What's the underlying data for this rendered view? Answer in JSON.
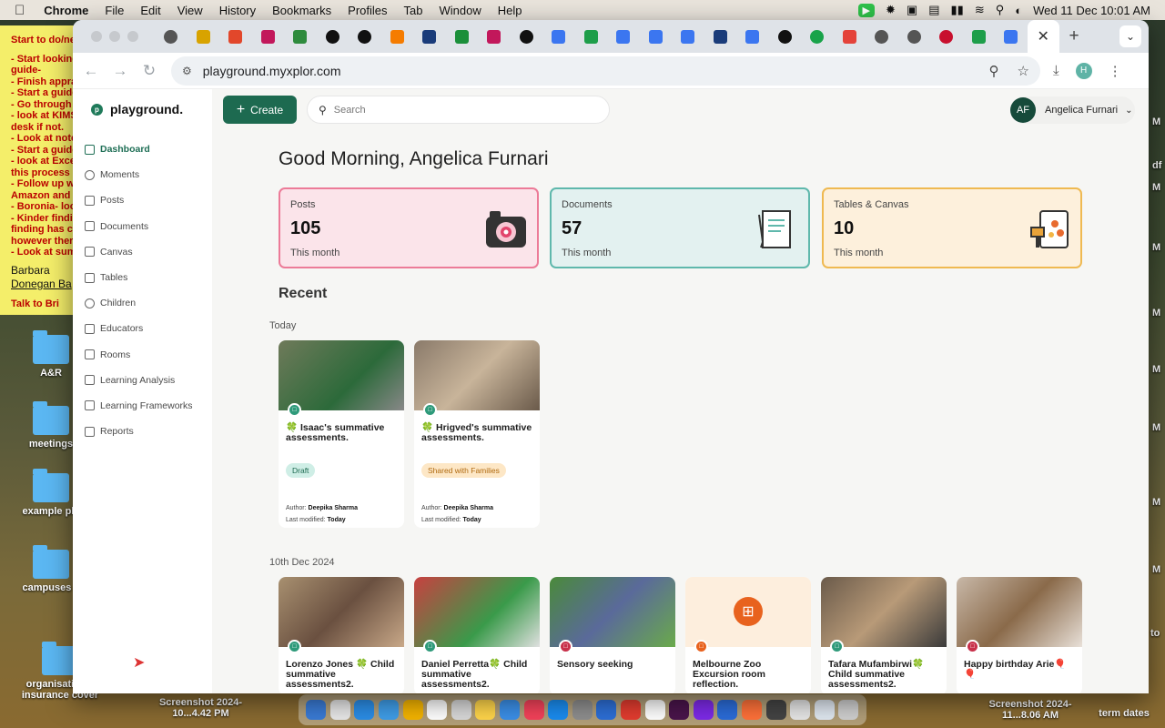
{
  "menubar": {
    "app": "Chrome",
    "items": [
      "File",
      "Edit",
      "View",
      "History",
      "Bookmarks",
      "Profiles",
      "Tab",
      "Window",
      "Help"
    ],
    "datetime": "Wed 11 Dec  10:01 AM"
  },
  "desktop": {
    "sticky_lines": [
      "Start to do/ne",
      "",
      "- Start looking",
      "guide-",
      "- Finish appra",
      "- Start a guide",
      "- Go through",
      "- look at KIMS",
      "desk if not.",
      "- Look at note",
      "- Start a guide",
      "- look at Exce",
      "this process",
      "- Follow up w",
      "Amazon and",
      "- Boronia- loo",
      "- Kinder findi",
      "finding has c",
      "however ther",
      "- Look at sum"
    ],
    "sticky_names": [
      "Barbara",
      "Donegan Ba"
    ],
    "sticky_bottom": "Talk to Bri",
    "items": [
      {
        "label": "A&R"
      },
      {
        "label": "meetings"
      },
      {
        "label": "example pla"
      },
      {
        "label": "campuses s"
      },
      {
        "label": "organisation's insurance cover"
      }
    ],
    "screenshot_left": "Screenshot 2024-10...4.42 PM",
    "screenshot_right": "Screenshot 2024-11...8.06 AM",
    "term_dates": "term dates",
    "edge_labels": [
      "M",
      "df",
      "M",
      "M",
      "M",
      "M",
      "M",
      "M",
      "M",
      "to"
    ]
  },
  "browser": {
    "url": "playground.myxplor.com",
    "profile_initial": "H"
  },
  "app": {
    "logo": "playground.",
    "nav": [
      "Dashboard",
      "Moments",
      "Posts",
      "Documents",
      "Canvas",
      "Tables",
      "Children",
      "Educators",
      "Rooms",
      "Learning Analysis",
      "Learning Frameworks",
      "Reports"
    ],
    "create_label": "Create",
    "search_placeholder": "Search",
    "user": {
      "initials": "AF",
      "name": "Angelica Furnari"
    },
    "greeting": "Good Morning, Angelica Furnari",
    "stats": [
      {
        "label": "Posts",
        "value": "105",
        "sub": "This month"
      },
      {
        "label": "Documents",
        "value": "57",
        "sub": "This month"
      },
      {
        "label": "Tables & Canvas",
        "value": "10",
        "sub": "This month"
      }
    ],
    "recent_title": "Recent",
    "groups": [
      {
        "label": "Today",
        "cards": [
          {
            "title": "🍀 Isaac's summative assessments.",
            "status": "Draft",
            "author_label": "Author:",
            "author": "Deepika Sharma",
            "modified_label": "Last modified:",
            "modified": "Today"
          },
          {
            "title": "🍀 Hrigved's summative assessments.",
            "status": "Shared with Families",
            "author_label": "Author:",
            "author": "Deepika Sharma",
            "modified_label": "Last modified:",
            "modified": "Today"
          }
        ]
      },
      {
        "label": "10th Dec 2024",
        "cards": [
          {
            "title": "Lorenzo Jones 🍀 Child summative assessments2."
          },
          {
            "title": "Daniel Perretta🍀 Child summative assessments2."
          },
          {
            "title": "Sensory seeking"
          },
          {
            "title": "Melbourne Zoo Excursion room reflection."
          },
          {
            "title": "Tafara Mufambirwi🍀 Child summative assessments2."
          },
          {
            "title": "Happy birthday Arie🎈🎈"
          }
        ]
      }
    ]
  }
}
